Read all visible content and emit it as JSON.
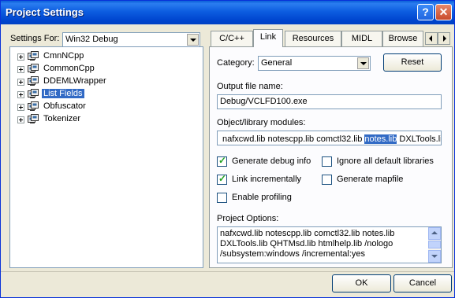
{
  "window": {
    "title": "Project Settings",
    "help_label": "?",
    "close_label": "✕"
  },
  "settings_for": {
    "label_pre": "Settings For:",
    "value": "Win32 Debug"
  },
  "tree": {
    "items": [
      {
        "label": "CmnNCpp",
        "selected": false
      },
      {
        "label": "CommonCpp",
        "selected": false
      },
      {
        "label": "DDEMLWrapper",
        "selected": false
      },
      {
        "label": "List Fields",
        "selected": true
      },
      {
        "label": "Obfuscator",
        "selected": false
      },
      {
        "label": "Tokenizer",
        "selected": false
      }
    ]
  },
  "tabs": [
    {
      "label": "C/C++",
      "active": false
    },
    {
      "label": "Link",
      "active": true
    },
    {
      "label": "Resources",
      "active": false
    },
    {
      "label": "MIDL",
      "active": false
    },
    {
      "label": "Browse",
      "active": false
    }
  ],
  "link": {
    "category_label": "Category:",
    "category_value": "General",
    "reset_label": "Reset",
    "output_label": "Output file name:",
    "output_value": "Debug/VCLFD100.exe",
    "modules_label": "Object/library modules:",
    "modules_pre": "nafxcwd.lib notescpp.lib comctl32.lib ",
    "modules_sel": "notes.lib",
    "modules_post": " DXLTools.lib",
    "checks": {
      "gen_debug": {
        "label": "Generate debug info",
        "checked": true
      },
      "ignore_libs": {
        "label": "Ignore all default libraries",
        "checked": false
      },
      "link_inc": {
        "label": "Link incrementally",
        "checked": true
      },
      "gen_map": {
        "label": "Generate mapfile",
        "checked": false
      },
      "profiling": {
        "label": "Enable profiling",
        "checked": false
      }
    },
    "options_label": "Project Options:",
    "options_lines": [
      "nafxcwd.lib notescpp.lib comctl32.lib notes.lib",
      "DXLTools.lib QHTMsd.lib htmlhelp.lib /nologo",
      "/subsystem:windows /incremental:yes"
    ]
  },
  "buttons": {
    "ok": "OK",
    "cancel": "Cancel"
  }
}
